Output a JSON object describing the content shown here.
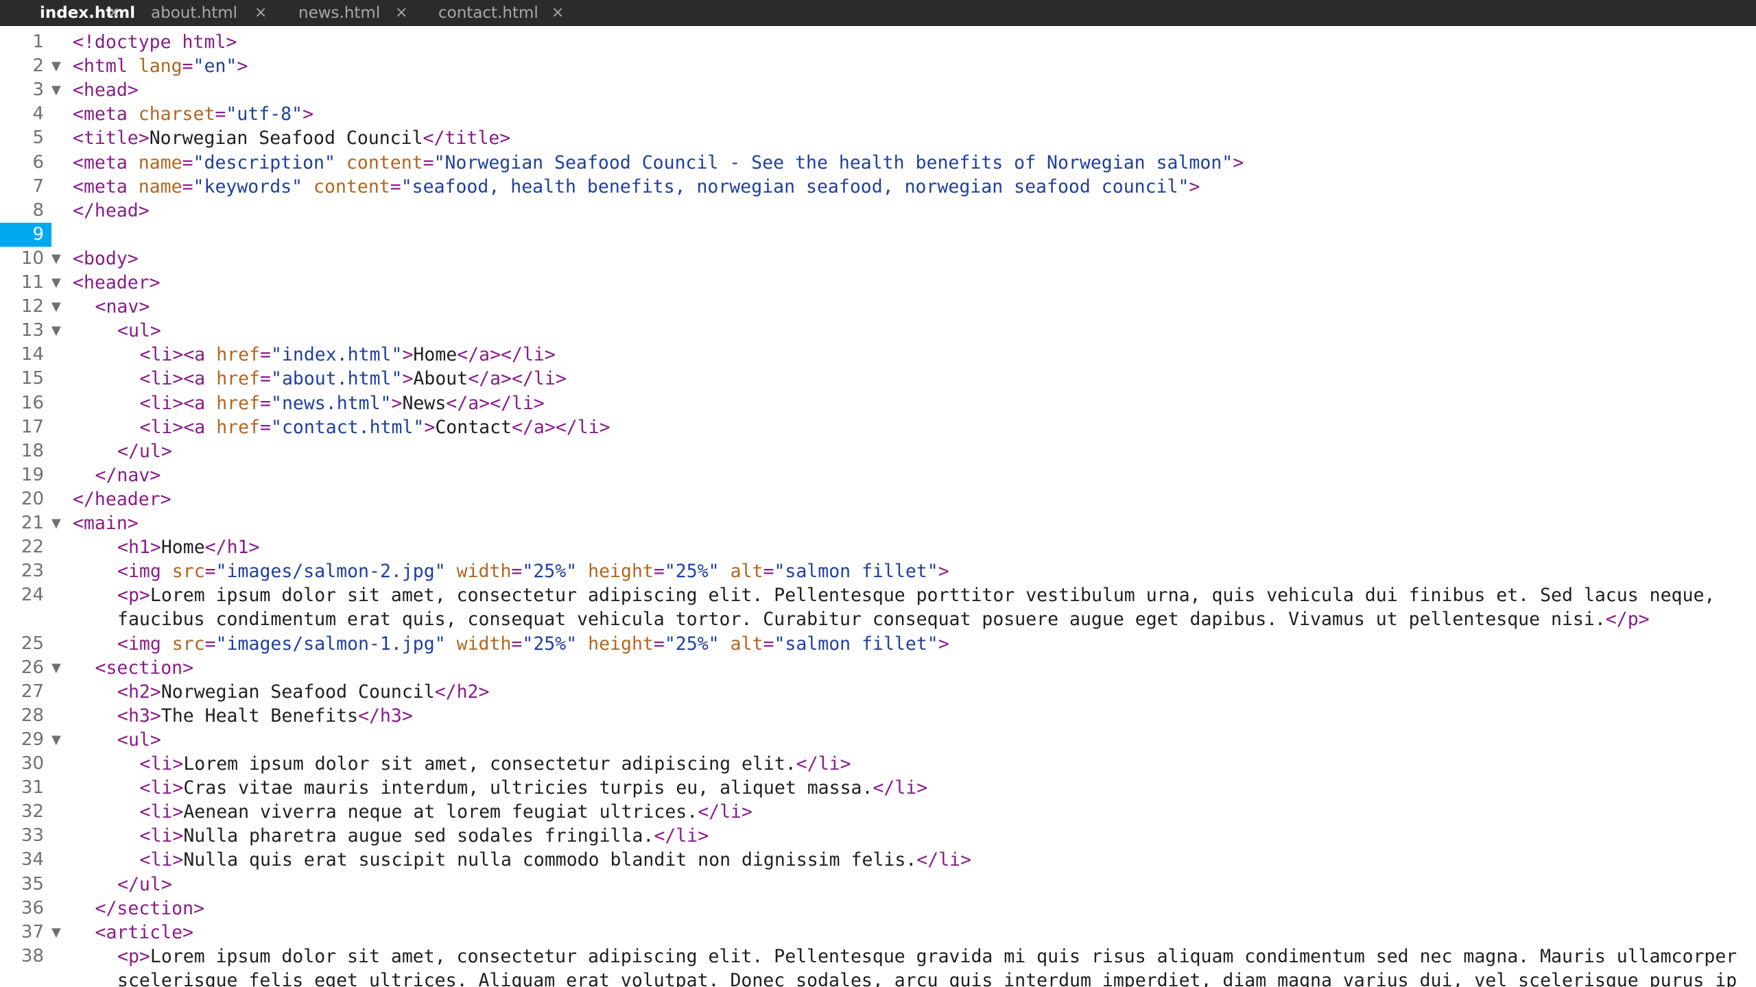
{
  "tabs": [
    {
      "label": "index.html",
      "active": true
    },
    {
      "label": "about.html",
      "active": false
    },
    {
      "label": "news.html",
      "active": false
    },
    {
      "label": "contact.html",
      "active": false
    }
  ],
  "close_glyph": "×",
  "current_line": 9,
  "colors": {
    "tag": "#8a1c8a",
    "attribute": "#b5651d",
    "string": "#1f3fa0",
    "text": "#1f1f1f",
    "current_line": "#00a8f0"
  },
  "lines": [
    {
      "n": "1",
      "fold": false,
      "indent": 0,
      "segs": [
        [
          "t",
          "<!doctype html>"
        ]
      ]
    },
    {
      "n": "2",
      "fold": true,
      "indent": 0,
      "segs": [
        [
          "t",
          "<html "
        ],
        [
          "a",
          "lang"
        ],
        [
          "t",
          "="
        ],
        [
          "v",
          "\"en\""
        ],
        [
          "t",
          ">"
        ]
      ]
    },
    {
      "n": "3",
      "fold": true,
      "indent": 0,
      "segs": [
        [
          "t",
          "<head>"
        ]
      ]
    },
    {
      "n": "4",
      "fold": false,
      "indent": 0,
      "segs": [
        [
          "t",
          "<meta "
        ],
        [
          "a",
          "charset"
        ],
        [
          "t",
          "="
        ],
        [
          "v",
          "\"utf-8\""
        ],
        [
          "t",
          ">"
        ]
      ]
    },
    {
      "n": "5",
      "fold": false,
      "indent": 0,
      "segs": [
        [
          "t",
          "<title>"
        ],
        [
          "x",
          "Norwegian Seafood Council"
        ],
        [
          "t",
          "</title>"
        ]
      ]
    },
    {
      "n": "6",
      "fold": false,
      "indent": 0,
      "segs": [
        [
          "t",
          "<meta "
        ],
        [
          "a",
          "name"
        ],
        [
          "t",
          "="
        ],
        [
          "v",
          "\"description\""
        ],
        [
          "t",
          " "
        ],
        [
          "a",
          "content"
        ],
        [
          "t",
          "="
        ],
        [
          "v",
          "\"Norwegian Seafood Council - See the health benefits of Norwegian salmon\""
        ],
        [
          "t",
          ">"
        ]
      ]
    },
    {
      "n": "7",
      "fold": false,
      "indent": 0,
      "segs": [
        [
          "t",
          "<meta "
        ],
        [
          "a",
          "name"
        ],
        [
          "t",
          "="
        ],
        [
          "v",
          "\"keywords\""
        ],
        [
          "t",
          " "
        ],
        [
          "a",
          "content"
        ],
        [
          "t",
          "="
        ],
        [
          "v",
          "\"seafood, health benefits, norwegian seafood, norwegian seafood council\""
        ],
        [
          "t",
          ">"
        ]
      ]
    },
    {
      "n": "8",
      "fold": false,
      "indent": 0,
      "segs": [
        [
          "t",
          "</head>"
        ]
      ]
    },
    {
      "n": "9",
      "fold": false,
      "indent": 0,
      "segs": []
    },
    {
      "n": "10",
      "fold": true,
      "indent": 0,
      "segs": [
        [
          "t",
          "<body>"
        ]
      ]
    },
    {
      "n": "11",
      "fold": true,
      "indent": 0,
      "segs": [
        [
          "t",
          "<header>"
        ]
      ]
    },
    {
      "n": "12",
      "fold": true,
      "indent": 1,
      "segs": [
        [
          "t",
          "<nav>"
        ]
      ]
    },
    {
      "n": "13",
      "fold": true,
      "indent": 2,
      "segs": [
        [
          "t",
          "<ul>"
        ]
      ]
    },
    {
      "n": "14",
      "fold": false,
      "indent": 3,
      "segs": [
        [
          "t",
          "<li><a "
        ],
        [
          "a",
          "href"
        ],
        [
          "t",
          "="
        ],
        [
          "v",
          "\"index.html\""
        ],
        [
          "t",
          ">"
        ],
        [
          "x",
          "Home"
        ],
        [
          "t",
          "</a></li>"
        ]
      ]
    },
    {
      "n": "15",
      "fold": false,
      "indent": 3,
      "segs": [
        [
          "t",
          "<li><a "
        ],
        [
          "a",
          "href"
        ],
        [
          "t",
          "="
        ],
        [
          "v",
          "\"about.html\""
        ],
        [
          "t",
          ">"
        ],
        [
          "x",
          "About"
        ],
        [
          "t",
          "</a></li>"
        ]
      ]
    },
    {
      "n": "16",
      "fold": false,
      "indent": 3,
      "segs": [
        [
          "t",
          "<li><a "
        ],
        [
          "a",
          "href"
        ],
        [
          "t",
          "="
        ],
        [
          "v",
          "\"news.html\""
        ],
        [
          "t",
          ">"
        ],
        [
          "x",
          "News"
        ],
        [
          "t",
          "</a></li>"
        ]
      ]
    },
    {
      "n": "17",
      "fold": false,
      "indent": 3,
      "segs": [
        [
          "t",
          "<li><a "
        ],
        [
          "a",
          "href"
        ],
        [
          "t",
          "="
        ],
        [
          "v",
          "\"contact.html\""
        ],
        [
          "t",
          ">"
        ],
        [
          "x",
          "Contact"
        ],
        [
          "t",
          "</a></li>"
        ]
      ]
    },
    {
      "n": "18",
      "fold": false,
      "indent": 2,
      "segs": [
        [
          "t",
          "</ul>"
        ]
      ]
    },
    {
      "n": "19",
      "fold": false,
      "indent": 1,
      "segs": [
        [
          "t",
          "</nav>"
        ]
      ]
    },
    {
      "n": "20",
      "fold": false,
      "indent": 0,
      "segs": [
        [
          "t",
          "</header>"
        ]
      ]
    },
    {
      "n": "21",
      "fold": true,
      "indent": 0,
      "segs": [
        [
          "t",
          "<main>"
        ]
      ]
    },
    {
      "n": "22",
      "fold": false,
      "indent": 2,
      "segs": [
        [
          "t",
          "<h1>"
        ],
        [
          "x",
          "Home"
        ],
        [
          "t",
          "</h1>"
        ]
      ]
    },
    {
      "n": "23",
      "fold": false,
      "indent": 2,
      "segs": [
        [
          "t",
          "<img "
        ],
        [
          "a",
          "src"
        ],
        [
          "t",
          "="
        ],
        [
          "v",
          "\"images/salmon-2.jpg\""
        ],
        [
          "t",
          " "
        ],
        [
          "a",
          "width"
        ],
        [
          "t",
          "="
        ],
        [
          "v",
          "\"25%\""
        ],
        [
          "t",
          " "
        ],
        [
          "a",
          "height"
        ],
        [
          "t",
          "="
        ],
        [
          "v",
          "\"25%\""
        ],
        [
          "t",
          " "
        ],
        [
          "a",
          "alt"
        ],
        [
          "t",
          "="
        ],
        [
          "v",
          "\"salmon fillet\""
        ],
        [
          "t",
          ">"
        ]
      ]
    },
    {
      "n": "24",
      "fold": false,
      "indent": 2,
      "segs": [
        [
          "t",
          "<p>"
        ],
        [
          "x",
          "Lorem ipsum dolor sit amet, consectetur adipiscing elit. Pellentesque porttitor vestibulum urna, quis vehicula dui finibus et. Sed lacus neque,"
        ]
      ]
    },
    {
      "n": "",
      "fold": false,
      "indent": 2,
      "segs": [
        [
          "x",
          "faucibus condimentum erat quis, consequat vehicula tortor. Curabitur consequat posuere augue eget dapibus. Vivamus ut pellentesque nisi."
        ],
        [
          "t",
          "</p>"
        ]
      ]
    },
    {
      "n": "25",
      "fold": false,
      "indent": 2,
      "segs": [
        [
          "t",
          "<img "
        ],
        [
          "a",
          "src"
        ],
        [
          "t",
          "="
        ],
        [
          "v",
          "\"images/salmon-1.jpg\""
        ],
        [
          "t",
          " "
        ],
        [
          "a",
          "width"
        ],
        [
          "t",
          "="
        ],
        [
          "v",
          "\"25%\""
        ],
        [
          "t",
          " "
        ],
        [
          "a",
          "height"
        ],
        [
          "t",
          "="
        ],
        [
          "v",
          "\"25%\""
        ],
        [
          "t",
          " "
        ],
        [
          "a",
          "alt"
        ],
        [
          "t",
          "="
        ],
        [
          "v",
          "\"salmon fillet\""
        ],
        [
          "t",
          ">"
        ]
      ]
    },
    {
      "n": "26",
      "fold": true,
      "indent": 1,
      "segs": [
        [
          "t",
          "<section>"
        ]
      ]
    },
    {
      "n": "27",
      "fold": false,
      "indent": 2,
      "segs": [
        [
          "t",
          "<h2>"
        ],
        [
          "x",
          "Norwegian Seafood Council"
        ],
        [
          "t",
          "</h2>"
        ]
      ]
    },
    {
      "n": "28",
      "fold": false,
      "indent": 2,
      "segs": [
        [
          "t",
          "<h3>"
        ],
        [
          "x",
          "The Healt Benefits"
        ],
        [
          "t",
          "</h3>"
        ]
      ]
    },
    {
      "n": "29",
      "fold": true,
      "indent": 2,
      "segs": [
        [
          "t",
          "<ul>"
        ]
      ]
    },
    {
      "n": "30",
      "fold": false,
      "indent": 3,
      "segs": [
        [
          "t",
          "<li>"
        ],
        [
          "x",
          "Lorem ipsum dolor sit amet, consectetur adipiscing elit."
        ],
        [
          "t",
          "</li>"
        ]
      ]
    },
    {
      "n": "31",
      "fold": false,
      "indent": 3,
      "segs": [
        [
          "t",
          "<li>"
        ],
        [
          "x",
          "Cras vitae mauris interdum, ultricies turpis eu, aliquet massa."
        ],
        [
          "t",
          "</li>"
        ]
      ]
    },
    {
      "n": "32",
      "fold": false,
      "indent": 3,
      "segs": [
        [
          "t",
          "<li>"
        ],
        [
          "x",
          "Aenean viverra neque at lorem feugiat ultrices."
        ],
        [
          "t",
          "</li>"
        ]
      ]
    },
    {
      "n": "33",
      "fold": false,
      "indent": 3,
      "segs": [
        [
          "t",
          "<li>"
        ],
        [
          "x",
          "Nulla pharetra augue sed sodales fringilla."
        ],
        [
          "t",
          "</li>"
        ]
      ]
    },
    {
      "n": "34",
      "fold": false,
      "indent": 3,
      "segs": [
        [
          "t",
          "<li>"
        ],
        [
          "x",
          "Nulla quis erat suscipit nulla commodo blandit non dignissim felis."
        ],
        [
          "t",
          "</li>"
        ]
      ]
    },
    {
      "n": "35",
      "fold": false,
      "indent": 2,
      "segs": [
        [
          "t",
          "</ul>"
        ]
      ]
    },
    {
      "n": "36",
      "fold": false,
      "indent": 1,
      "segs": [
        [
          "t",
          "</section>"
        ]
      ]
    },
    {
      "n": "37",
      "fold": true,
      "indent": 1,
      "segs": [
        [
          "t",
          "<article>"
        ]
      ]
    },
    {
      "n": "38",
      "fold": false,
      "indent": 2,
      "segs": [
        [
          "t",
          "<p>"
        ],
        [
          "x",
          "Lorem ipsum dolor sit amet, consectetur adipiscing elit. Pellentesque gravida mi quis risus aliquam condimentum sed nec magna. Mauris ullamcorper"
        ]
      ]
    },
    {
      "n": "",
      "fold": false,
      "indent": 2,
      "segs": [
        [
          "x",
          "scelerisque felis eget ultrices. Aliquam erat volutpat. Donec sodales, arcu quis interdum imperdiet, diam magna varius dui, vel scelerisque purus ip"
        ]
      ]
    }
  ]
}
